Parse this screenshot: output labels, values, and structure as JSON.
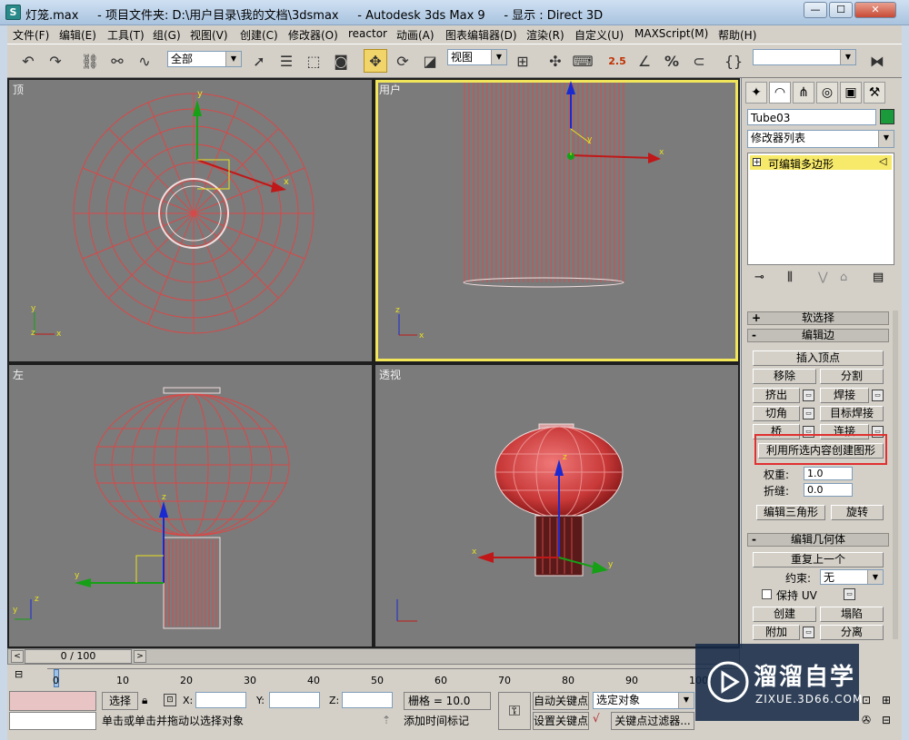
{
  "window": {
    "title": "灯笼.max     - 项目文件夹: D:\\用户目录\\我的文档\\3dsmax     - Autodesk 3ds Max 9     - 显示 : Direct 3D",
    "app_icon": "3ds-max-icon"
  },
  "menu": [
    "文件(F)",
    "编辑(E)",
    "工具(T)",
    "组(G)",
    "视图(V)",
    "创建(C)",
    "修改器(O)",
    "reactor",
    "动画(A)",
    "图表编辑器(D)",
    "渲染(R)",
    "自定义(U)",
    "MAXScript(M)",
    "帮助(H)"
  ],
  "toolbar": {
    "selection_filter": "全部",
    "reference_coord": "视图",
    "snap_label": "2.5",
    "percent_snap_label": "%",
    "icons": [
      "undo-icon",
      "redo-icon",
      "select-link-icon",
      "unlink-icon",
      "bind-space-warp-icon",
      "select-object-icon",
      "select-by-name-icon",
      "rectangular-region-icon",
      "window-crossing-icon",
      "select-move-icon",
      "select-rotate-icon",
      "select-scale-icon",
      "pivot-icon",
      "manipulate-icon",
      "keyboard-shortcut-icon",
      "snap-toggle-icon",
      "angle-snap-icon",
      "percent-snap-icon",
      "spinner-snap-icon",
      "named-selection-icon",
      "mirror-icon"
    ]
  },
  "viewports": {
    "top": "顶",
    "user": "用户",
    "left": "左",
    "perspective": "透视",
    "axis_x": "x",
    "axis_y": "y",
    "axis_z": "z"
  },
  "command_panel": {
    "tabs": [
      "create-icon",
      "modify-icon",
      "hierarchy-icon",
      "motion-icon",
      "display-icon",
      "utilities-icon"
    ],
    "object_name": "Tube03",
    "object_color": "#1a9a3a",
    "modifier_list_label": "修改器列表",
    "stack_item": "可编辑多边形",
    "rollouts": {
      "soft_selection": {
        "sign": "+",
        "title": "软选择"
      },
      "edit_edges": {
        "sign": "-",
        "title": "编辑边",
        "insert_vertex": "插入顶点",
        "remove": "移除",
        "split": "分割",
        "extrude": "挤出",
        "weld": "焊接",
        "chamfer": "切角",
        "target_weld": "目标焊接",
        "bridge": "桥",
        "connect": "连接",
        "create_shape": "利用所选内容创建图形",
        "weight_label": "权重:",
        "weight_value": "1.0",
        "crease_label": "折缝:",
        "crease_value": "0.0",
        "edit_tri": "编辑三角形",
        "turn": "旋转"
      },
      "edit_geometry": {
        "sign": "-",
        "title": "编辑几何体",
        "repeat_last": "重复上一个",
        "constraint_label": "约束:",
        "constraint_value": "无",
        "preserve_uvs": "保持 UV",
        "create": "创建",
        "collapse": "塌陷",
        "attach": "附加",
        "detach": "分离"
      }
    }
  },
  "timeline": {
    "frame_readout": "0 / 100",
    "ticks": [
      "0",
      "10",
      "20",
      "30",
      "40",
      "50",
      "60",
      "70",
      "80",
      "90",
      "100"
    ],
    "current_frame": 0
  },
  "status": {
    "selection_label": "选择",
    "x_label": "X:",
    "y_label": "Y:",
    "z_label": "Z:",
    "grid_readout": "栅格 = 10.0",
    "auto_key": "自动关键点",
    "set_key": "设置关键点",
    "key_filter_value": "选定对象",
    "key_filters": "关键点过滤器...",
    "prompt": "单击或单击并拖动以选择对象",
    "add_time_tag": "添加时间标记"
  },
  "watermark": {
    "brand": "溜溜自学",
    "url": "ZIXUE.3D66.COM"
  }
}
